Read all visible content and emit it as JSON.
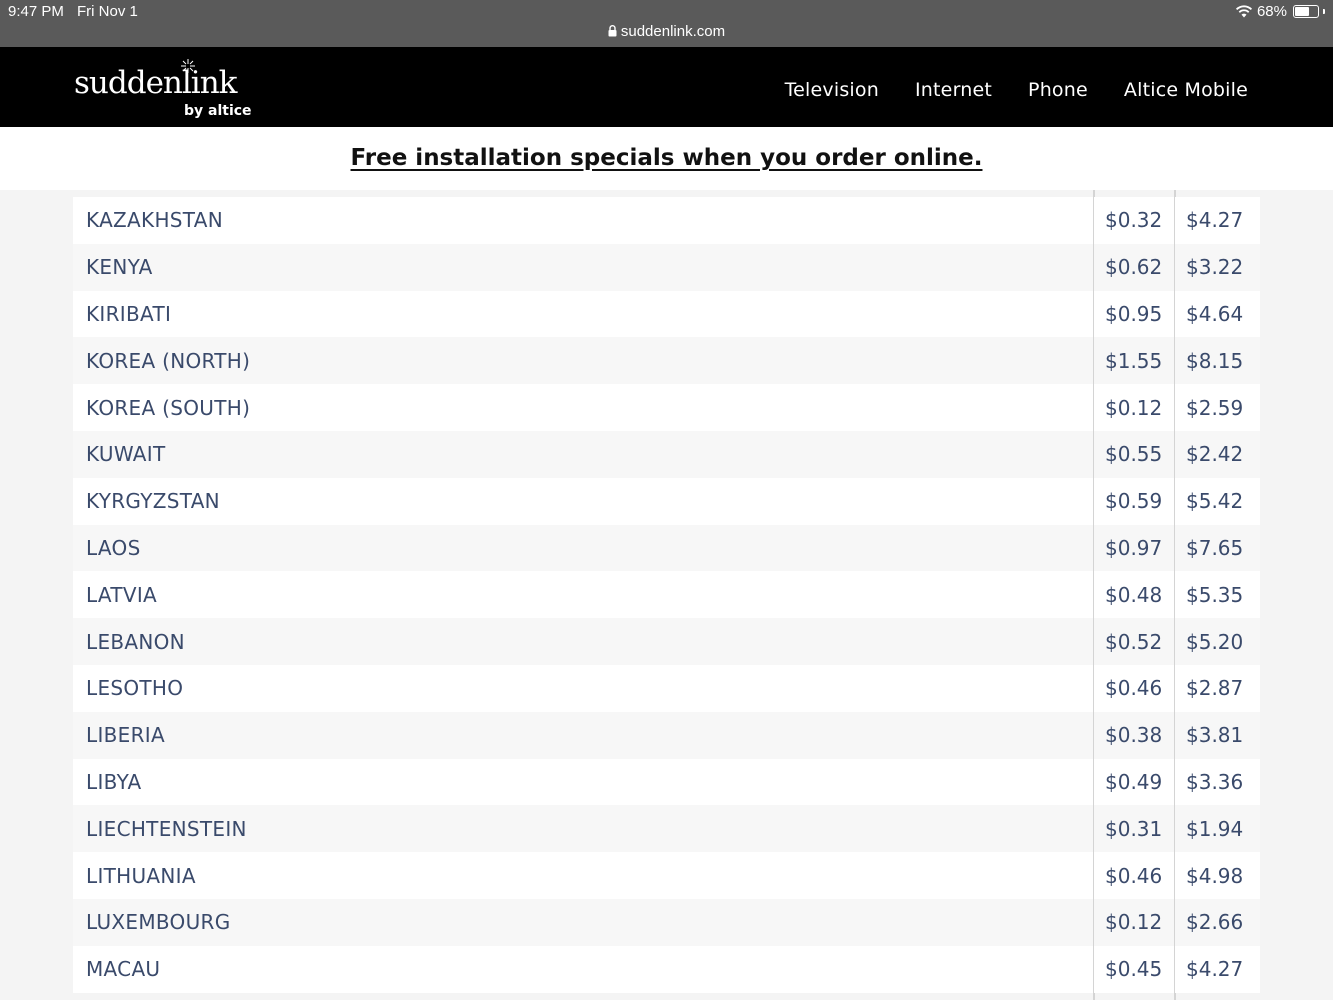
{
  "status_bar": {
    "time": "9:47 PM",
    "date": "Fri Nov 1",
    "battery": "68%",
    "battery_level": 0.68
  },
  "browser": {
    "url": "suddenlink.com"
  },
  "header": {
    "logo": {
      "main": "suddenlink",
      "sub": "by altice"
    },
    "nav": [
      "Television",
      "Internet",
      "Phone",
      "Altice Mobile"
    ]
  },
  "promo": {
    "text": "Free installation specials when you order online."
  },
  "rates": {
    "rows": [
      {
        "country": "KAZAKHSTAN",
        "landline": "$0.32",
        "mobile": "$4.27"
      },
      {
        "country": "KENYA",
        "landline": "$0.62",
        "mobile": "$3.22"
      },
      {
        "country": "KIRIBATI",
        "landline": "$0.95",
        "mobile": "$4.64"
      },
      {
        "country": "KOREA (NORTH)",
        "landline": "$1.55",
        "mobile": "$8.15"
      },
      {
        "country": "KOREA (SOUTH)",
        "landline": "$0.12",
        "mobile": "$2.59"
      },
      {
        "country": "KUWAIT",
        "landline": "$0.55",
        "mobile": "$2.42"
      },
      {
        "country": "KYRGYZSTAN",
        "landline": "$0.59",
        "mobile": "$5.42"
      },
      {
        "country": "LAOS",
        "landline": "$0.97",
        "mobile": "$7.65"
      },
      {
        "country": "LATVIA",
        "landline": "$0.48",
        "mobile": "$5.35"
      },
      {
        "country": "LEBANON",
        "landline": "$0.52",
        "mobile": "$5.20"
      },
      {
        "country": "LESOTHO",
        "landline": "$0.46",
        "mobile": "$2.87"
      },
      {
        "country": "LIBERIA",
        "landline": "$0.38",
        "mobile": "$3.81"
      },
      {
        "country": "LIBYA",
        "landline": "$0.49",
        "mobile": "$3.36"
      },
      {
        "country": "LIECHTENSTEIN",
        "landline": "$0.31",
        "mobile": "$1.94"
      },
      {
        "country": "LITHUANIA",
        "landline": "$0.46",
        "mobile": "$4.98"
      },
      {
        "country": "LUXEMBOURG",
        "landline": "$0.12",
        "mobile": "$2.66"
      },
      {
        "country": "MACAU",
        "landline": "$0.45",
        "mobile": "$4.27"
      }
    ]
  },
  "colors": {
    "header_bg": "#000000",
    "status_bg": "#5a5a5a",
    "table_text": "#3a4a6b",
    "row_alt": "#f7f7f7"
  }
}
